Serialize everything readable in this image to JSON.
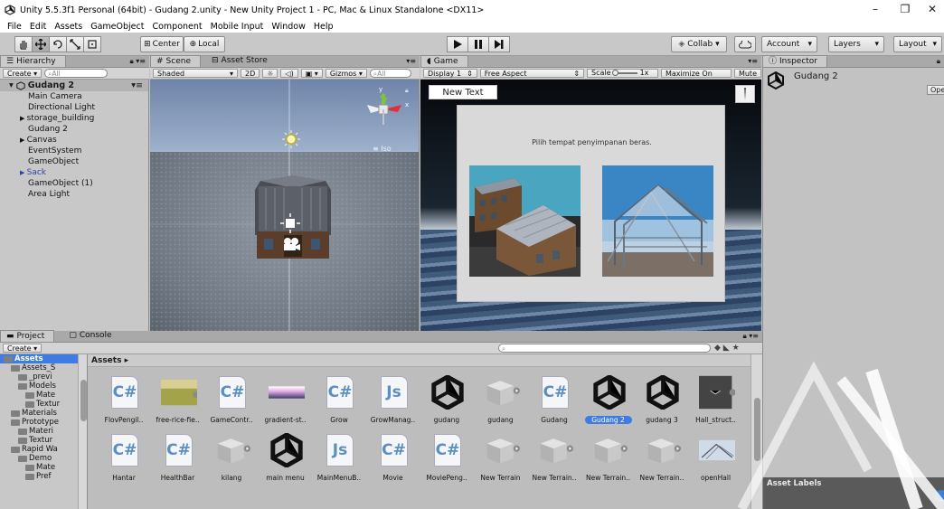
{
  "window": {
    "title": "Unity 5.5.3f1 Personal (64bit) - Gudang 2.unity - New Unity Project 1 - PC, Mac & Linux Standalone <DX11>",
    "minimize": "–",
    "maximize": "❐",
    "close": "✕"
  },
  "menu": [
    "File",
    "Edit",
    "Assets",
    "GameObject",
    "Component",
    "Mobile Input",
    "Window",
    "Help"
  ],
  "toolbar": {
    "pivot": "Center",
    "space": "Local",
    "collab": "Collab ▾",
    "account": "Account",
    "layers": "Layers",
    "layout": "Layout"
  },
  "hierarchy": {
    "tab": "Hierarchy",
    "create": "Create ▾",
    "search_placeholder": "All",
    "scene": "Gudang 2",
    "items": [
      {
        "label": "Main Camera",
        "expandable": false,
        "color": "#111111"
      },
      {
        "label": "Directional Light",
        "expandable": false,
        "color": "#111111"
      },
      {
        "label": "storage_building",
        "expandable": true,
        "color": "#111111"
      },
      {
        "label": "Gudang 2",
        "expandable": false,
        "color": "#111111"
      },
      {
        "label": "Canvas",
        "expandable": true,
        "color": "#111111"
      },
      {
        "label": "EventSystem",
        "expandable": false,
        "color": "#111111"
      },
      {
        "label": "GameObject",
        "expandable": false,
        "color": "#111111"
      },
      {
        "label": "Sack",
        "expandable": true,
        "color": "#2b45a8"
      },
      {
        "label": "GameObject (1)",
        "expandable": false,
        "color": "#111111"
      },
      {
        "label": "Area Light",
        "expandable": false,
        "color": "#111111"
      }
    ]
  },
  "scene": {
    "tab": "Scene",
    "asset_store_tab": "Asset Store",
    "shading": "Shaded",
    "mode_2d": "2D",
    "gizmos": "Gizmos ▾",
    "search_placeholder": "All",
    "projection": "≡ Iso",
    "axis_y": "y",
    "axis_x": "x"
  },
  "game": {
    "tab": "Game",
    "display": "Display 1",
    "aspect": "Free Aspect",
    "scale_label": "Scale",
    "scale_value": "1x",
    "maximize": "Maximize On Play",
    "mute": "Mute",
    "button_text": "New Text",
    "prompt": "Pilih tempat penyimpanan beras."
  },
  "inspector": {
    "tab": "Inspector",
    "object": "Gudang 2",
    "open": "Ope",
    "asset_labels": "Asset Labels"
  },
  "project": {
    "tab": "Project",
    "console_tab": "Console",
    "create": "Create ▾",
    "breadcrumb": "Assets ▸",
    "tree": [
      {
        "label": "Assets",
        "indent": 1,
        "selected": true
      },
      {
        "label": "Assets_S",
        "indent": 2,
        "selected": false
      },
      {
        "label": "_previ",
        "indent": 3,
        "selected": false
      },
      {
        "label": "Models",
        "indent": 3,
        "selected": false
      },
      {
        "label": "Mate",
        "indent": 4,
        "selected": false
      },
      {
        "label": "Textur",
        "indent": 4,
        "selected": false
      },
      {
        "label": "Materials",
        "indent": 2,
        "selected": false
      },
      {
        "label": "Prototype",
        "indent": 2,
        "selected": false
      },
      {
        "label": "Materi",
        "indent": 3,
        "selected": false
      },
      {
        "label": "Textur",
        "indent": 3,
        "selected": false
      },
      {
        "label": "Rapid Wa",
        "indent": 2,
        "selected": false
      },
      {
        "label": "Demo",
        "indent": 3,
        "selected": false
      },
      {
        "label": "Mate",
        "indent": 4,
        "selected": false
      },
      {
        "label": "Pref",
        "indent": 4,
        "selected": false
      }
    ],
    "assets_row1": [
      {
        "label": "FlovPengil..",
        "kind": "cs"
      },
      {
        "label": "free-rice-fie..",
        "kind": "image"
      },
      {
        "label": "GameContr..",
        "kind": "cs"
      },
      {
        "label": "gradient-st..",
        "kind": "gradient"
      },
      {
        "label": "Grow",
        "kind": "cs"
      },
      {
        "label": "GrowManag..",
        "kind": "js"
      },
      {
        "label": "gudang",
        "kind": "unity"
      },
      {
        "label": "gudang",
        "kind": "prefab"
      },
      {
        "label": "Gudang",
        "kind": "cs"
      },
      {
        "label": "Gudang 2",
        "kind": "unity",
        "selected": true
      },
      {
        "label": "gudang 3",
        "kind": "unity"
      },
      {
        "label": "Hall_struct..",
        "kind": "dark"
      }
    ],
    "assets_row2": [
      {
        "label": "Hantar",
        "kind": "cs"
      },
      {
        "label": "HealthBar",
        "kind": "cs"
      },
      {
        "label": "kilang",
        "kind": "prefab"
      },
      {
        "label": "main menu",
        "kind": "unity"
      },
      {
        "label": "MainMenuB..",
        "kind": "js"
      },
      {
        "label": "Movie",
        "kind": "cs"
      },
      {
        "label": "MoviePeng..",
        "kind": "cs"
      },
      {
        "label": "New Terrain",
        "kind": "prefab"
      },
      {
        "label": "New Terrain..",
        "kind": "prefab"
      },
      {
        "label": "New Terrain..",
        "kind": "prefab"
      },
      {
        "label": "New Terrain..",
        "kind": "prefab"
      },
      {
        "label": "openHall",
        "kind": "hall"
      }
    ]
  }
}
